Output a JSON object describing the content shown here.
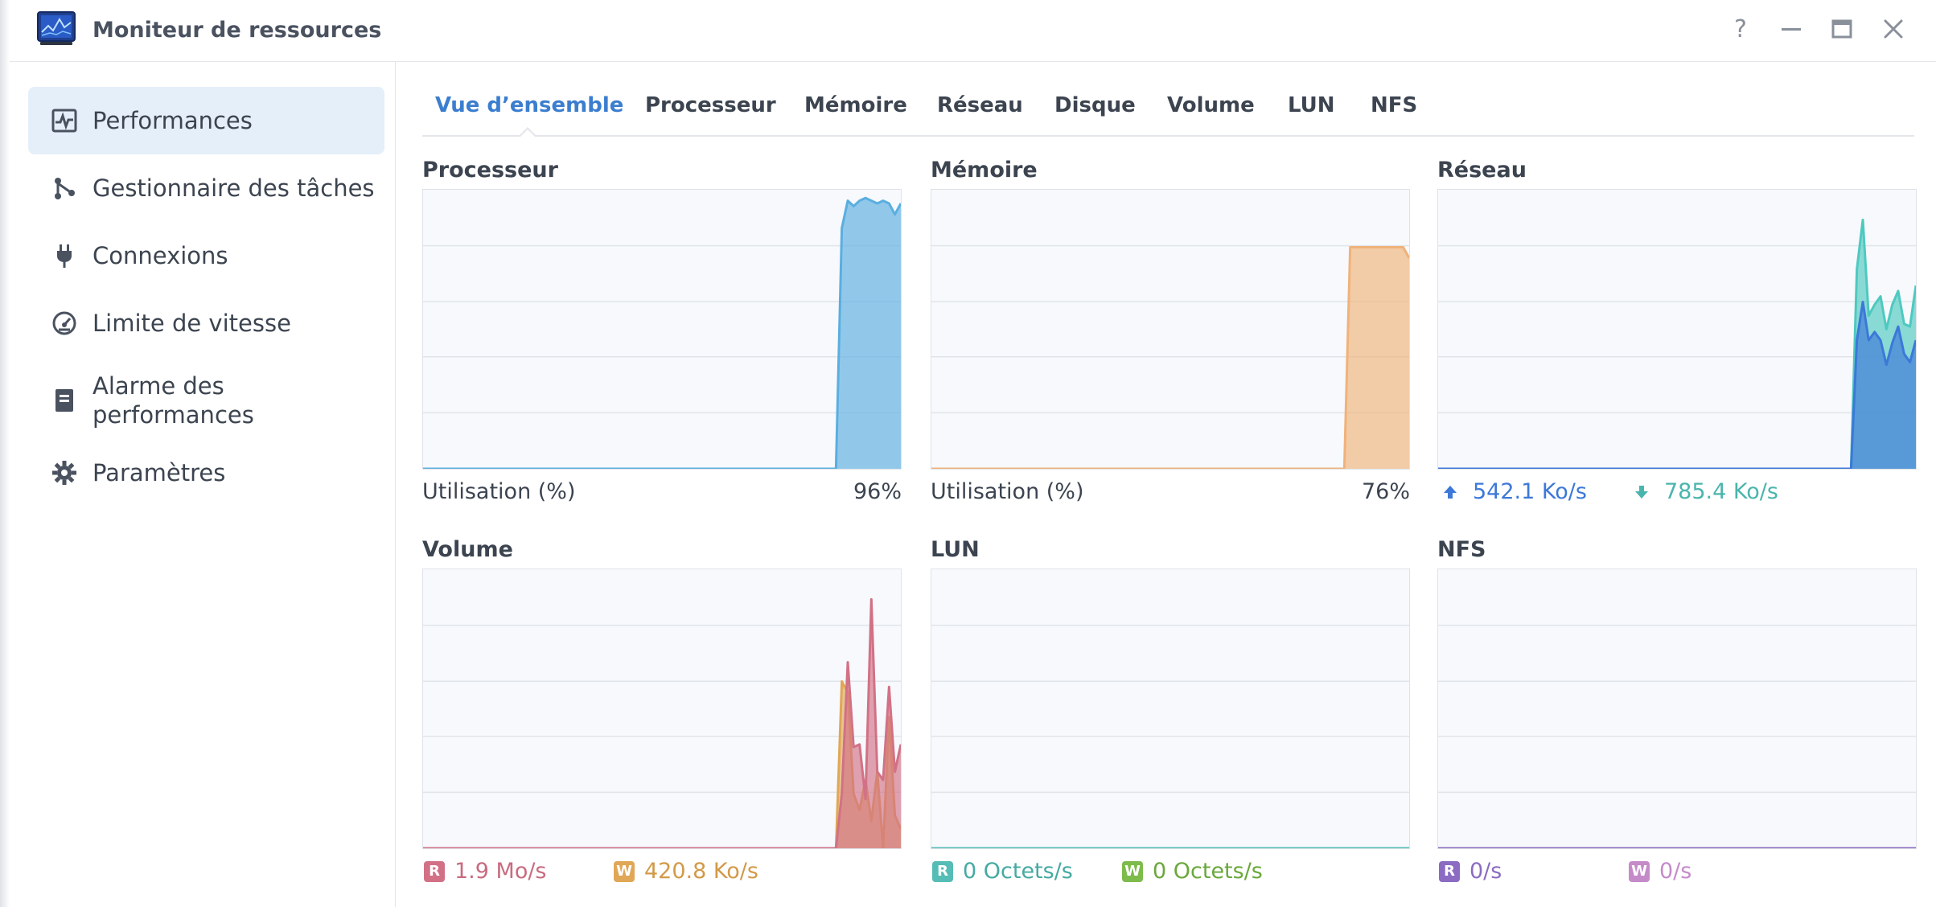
{
  "window": {
    "title": "Moniteur de ressources",
    "help_icon": "question-icon",
    "minimize_icon": "minimize-icon",
    "maximize_icon": "maximize-icon",
    "close_icon": "close-icon"
  },
  "sidebar": {
    "items": [
      {
        "label": "Performances",
        "icon": "performance-chart-icon",
        "active": true
      },
      {
        "label": "Gestionnaire des tâches",
        "icon": "task-manager-icon",
        "active": false
      },
      {
        "label": "Connexions",
        "icon": "plug-icon",
        "active": false
      },
      {
        "label": "Limite de vitesse",
        "icon": "speedometer-icon",
        "active": false
      },
      {
        "label": "Alarme des performances",
        "label_line1": "Alarme des",
        "label_line2": "performances",
        "icon": "alarm-document-icon",
        "active": false
      },
      {
        "label": "Paramètres",
        "icon": "gear-icon",
        "active": false
      }
    ]
  },
  "tabs": [
    "Vue d’ensemble",
    "Processeur",
    "Mémoire",
    "Réseau",
    "Disque",
    "Volume",
    "LUN",
    "NFS"
  ],
  "active_tab": "Vue d’ensemble",
  "colors": {
    "accent": "#3b7ecf",
    "cpu": "#5aaee0",
    "memory": "#f0b27a",
    "net_up": "#3c78d8",
    "net_down": "#4ec9c0",
    "read": "#d27186",
    "write": "#e0a757",
    "lun_read": "#55bdb5",
    "lun_write": "#7dbb4a",
    "nfs_read": "#8b6cc2",
    "nfs_write": "#c58bc9"
  },
  "panels": {
    "cpu": {
      "title": "Processeur",
      "caption": "Utilisation  (%)",
      "value": "96%"
    },
    "memory": {
      "title": "Mémoire",
      "caption": "Utilisation  (%)",
      "value": "76%"
    },
    "network": {
      "title": "Réseau",
      "up_value": "542.1 Ko/s",
      "down_value": "785.4 Ko/s"
    },
    "volume": {
      "title": "Volume",
      "read_badge": "R",
      "read_value": "1.9 Mo/s",
      "write_badge": "W",
      "write_value": "420.8 Ko/s"
    },
    "lun": {
      "title": "LUN",
      "read_badge": "R",
      "read_value": "0 Octets/s",
      "write_badge": "W",
      "write_value": "0 Octets/s"
    },
    "nfs": {
      "title": "NFS",
      "read_badge": "R",
      "read_value": "0/s",
      "write_badge": "W",
      "write_value": "0/s"
    }
  },
  "chart_data": [
    {
      "type": "area",
      "title": "Processeur",
      "ylabel": "Utilisation  (%)",
      "ylim": [
        0,
        100
      ],
      "series": [
        {
          "values": [
            0,
            0,
            0,
            0,
            0,
            0,
            0,
            0,
            0,
            0,
            0,
            0,
            0,
            0,
            0,
            0,
            0,
            0,
            0,
            0,
            0,
            0,
            0,
            0,
            0,
            0,
            0,
            0,
            0,
            0,
            0,
            0,
            0,
            0,
            0,
            0,
            0,
            0,
            0,
            0,
            0,
            0,
            0,
            0,
            0,
            0,
            0,
            0,
            0,
            0,
            0,
            0,
            0,
            0,
            0,
            0,
            0,
            0,
            0,
            0,
            0,
            0,
            0,
            0,
            0,
            0,
            0,
            0,
            0,
            0,
            0,
            88,
            98,
            96,
            98,
            99,
            98,
            97,
            98,
            97,
            93,
            97
          ]
        }
      ]
    },
    {
      "type": "area",
      "title": "Mémoire",
      "ylabel": "Utilisation  (%)",
      "ylim": [
        0,
        100
      ],
      "series": [
        {
          "values": [
            0,
            0,
            0,
            0,
            0,
            0,
            0,
            0,
            0,
            0,
            0,
            0,
            0,
            0,
            0,
            0,
            0,
            0,
            0,
            0,
            0,
            0,
            0,
            0,
            0,
            0,
            0,
            0,
            0,
            0,
            0,
            0,
            0,
            0,
            0,
            0,
            0,
            0,
            0,
            0,
            0,
            0,
            0,
            0,
            0,
            0,
            0,
            0,
            0,
            0,
            0,
            0,
            0,
            0,
            0,
            0,
            0,
            0,
            0,
            0,
            0,
            0,
            0,
            0,
            0,
            0,
            0,
            0,
            0,
            0,
            0,
            81,
            81,
            81,
            81,
            81,
            81,
            81,
            81,
            81,
            81,
            77
          ]
        }
      ]
    },
    {
      "type": "area",
      "title": "Réseau",
      "series": [
        {
          "values": [
            0,
            0,
            0,
            0,
            0,
            0,
            0,
            0,
            0,
            0,
            0,
            0,
            0,
            0,
            0,
            0,
            0,
            0,
            0,
            0,
            0,
            0,
            0,
            0,
            0,
            0,
            0,
            0,
            0,
            0,
            0,
            0,
            0,
            0,
            0,
            0,
            0,
            0,
            0,
            0,
            0,
            0,
            0,
            0,
            0,
            0,
            0,
            0,
            0,
            0,
            0,
            0,
            0,
            0,
            0,
            0,
            0,
            0,
            0,
            0,
            0,
            0,
            0,
            0,
            0,
            0,
            0,
            0,
            0,
            0,
            0,
            47,
            61,
            47,
            50,
            47,
            38,
            46,
            52,
            42,
            39,
            47
          ]
        },
        {
          "values": [
            0,
            0,
            0,
            0,
            0,
            0,
            0,
            0,
            0,
            0,
            0,
            0,
            0,
            0,
            0,
            0,
            0,
            0,
            0,
            0,
            0,
            0,
            0,
            0,
            0,
            0,
            0,
            0,
            0,
            0,
            0,
            0,
            0,
            0,
            0,
            0,
            0,
            0,
            0,
            0,
            0,
            0,
            0,
            0,
            0,
            0,
            0,
            0,
            0,
            0,
            0,
            0,
            0,
            0,
            0,
            0,
            0,
            0,
            0,
            0,
            0,
            0,
            0,
            0,
            0,
            0,
            0,
            0,
            0,
            0,
            0,
            73,
            91,
            56,
            60,
            63,
            51,
            60,
            65,
            53,
            52,
            67
          ]
        }
      ]
    },
    {
      "type": "area",
      "title": "Volume",
      "series": [
        {
          "values": [
            0,
            0,
            0,
            0,
            0,
            0,
            0,
            0,
            0,
            0,
            0,
            0,
            0,
            0,
            0,
            0,
            0,
            0,
            0,
            0,
            0,
            0,
            0,
            0,
            0,
            0,
            0,
            0,
            0,
            0,
            0,
            0,
            0,
            0,
            0,
            0,
            0,
            0,
            0,
            0,
            0,
            0,
            0,
            0,
            0,
            0,
            0,
            0,
            0,
            0,
            0,
            0,
            0,
            0,
            0,
            0,
            0,
            0,
            0,
            0,
            0,
            0,
            0,
            0,
            0,
            0,
            0,
            0,
            0,
            0,
            0,
            20,
            68,
            37,
            38,
            18,
            91,
            28,
            25,
            59,
            28,
            38
          ]
        },
        {
          "values": [
            0,
            0,
            0,
            0,
            0,
            0,
            0,
            0,
            0,
            0,
            0,
            0,
            0,
            0,
            0,
            0,
            0,
            0,
            0,
            0,
            0,
            0,
            0,
            0,
            0,
            0,
            0,
            0,
            0,
            0,
            0,
            0,
            0,
            0,
            0,
            0,
            0,
            0,
            0,
            0,
            0,
            0,
            0,
            0,
            0,
            0,
            0,
            0,
            0,
            0,
            0,
            0,
            0,
            0,
            0,
            0,
            0,
            0,
            0,
            0,
            0,
            0,
            0,
            0,
            0,
            0,
            0,
            0,
            0,
            0,
            0,
            61,
            57,
            20,
            14,
            25,
            10,
            28,
            0,
            48,
            12,
            7
          ]
        }
      ]
    },
    {
      "type": "area",
      "title": "LUN",
      "series": [
        {
          "values": [
            0,
            0,
            0,
            0,
            0,
            0,
            0,
            0,
            0,
            0,
            0,
            0,
            0,
            0,
            0,
            0,
            0,
            0,
            0,
            0,
            0,
            0,
            0,
            0,
            0,
            0,
            0,
            0,
            0,
            0,
            0,
            0,
            0,
            0,
            0,
            0,
            0,
            0,
            0,
            0,
            0,
            0,
            0,
            0,
            0,
            0,
            0,
            0,
            0,
            0,
            0,
            0,
            0,
            0,
            0,
            0,
            0,
            0,
            0,
            0,
            0,
            0,
            0,
            0,
            0,
            0,
            0,
            0,
            0,
            0,
            0,
            0,
            0,
            0,
            0,
            0,
            0,
            0,
            0,
            0,
            0,
            0
          ]
        },
        {
          "values": [
            0,
            0,
            0,
            0,
            0,
            0,
            0,
            0,
            0,
            0,
            0,
            0,
            0,
            0,
            0,
            0,
            0,
            0,
            0,
            0,
            0,
            0,
            0,
            0,
            0,
            0,
            0,
            0,
            0,
            0,
            0,
            0,
            0,
            0,
            0,
            0,
            0,
            0,
            0,
            0,
            0,
            0,
            0,
            0,
            0,
            0,
            0,
            0,
            0,
            0,
            0,
            0,
            0,
            0,
            0,
            0,
            0,
            0,
            0,
            0,
            0,
            0,
            0,
            0,
            0,
            0,
            0,
            0,
            0,
            0,
            0,
            0,
            0,
            0,
            0,
            0,
            0,
            0,
            0,
            0,
            0,
            0
          ]
        }
      ]
    },
    {
      "type": "area",
      "title": "NFS",
      "series": [
        {
          "values": [
            0,
            0,
            0,
            0,
            0,
            0,
            0,
            0,
            0,
            0,
            0,
            0,
            0,
            0,
            0,
            0,
            0,
            0,
            0,
            0,
            0,
            0,
            0,
            0,
            0,
            0,
            0,
            0,
            0,
            0,
            0,
            0,
            0,
            0,
            0,
            0,
            0,
            0,
            0,
            0,
            0,
            0,
            0,
            0,
            0,
            0,
            0,
            0,
            0,
            0,
            0,
            0,
            0,
            0,
            0,
            0,
            0,
            0,
            0,
            0,
            0,
            0,
            0,
            0,
            0,
            0,
            0,
            0,
            0,
            0,
            0,
            0,
            0,
            0,
            0,
            0,
            0,
            0,
            0,
            0,
            0,
            0
          ]
        },
        {
          "values": [
            0,
            0,
            0,
            0,
            0,
            0,
            0,
            0,
            0,
            0,
            0,
            0,
            0,
            0,
            0,
            0,
            0,
            0,
            0,
            0,
            0,
            0,
            0,
            0,
            0,
            0,
            0,
            0,
            0,
            0,
            0,
            0,
            0,
            0,
            0,
            0,
            0,
            0,
            0,
            0,
            0,
            0,
            0,
            0,
            0,
            0,
            0,
            0,
            0,
            0,
            0,
            0,
            0,
            0,
            0,
            0,
            0,
            0,
            0,
            0,
            0,
            0,
            0,
            0,
            0,
            0,
            0,
            0,
            0,
            0,
            0,
            0,
            0,
            0,
            0,
            0,
            0,
            0,
            0,
            0,
            0,
            0
          ]
        }
      ]
    }
  ]
}
